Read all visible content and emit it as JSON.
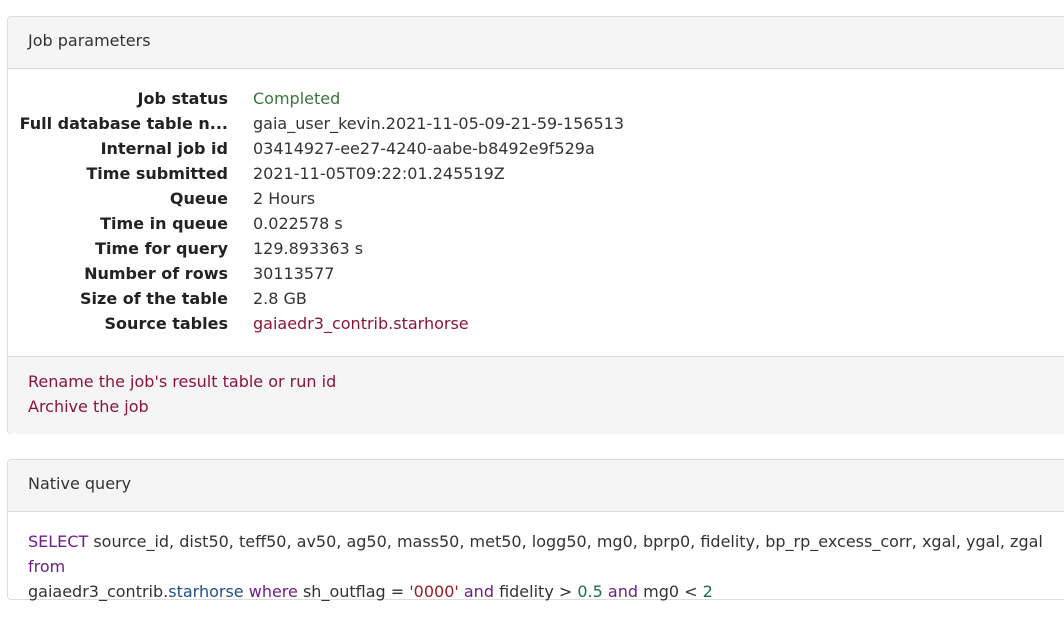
{
  "job_panel": {
    "title": "Job parameters",
    "rows": [
      {
        "label": "Job status",
        "value": "Completed"
      },
      {
        "label": "Full database table n...",
        "value": "gaia_user_kevin.2021-11-05-09-21-59-156513"
      },
      {
        "label": "Internal job id",
        "value": "03414927-ee27-4240-aabe-b8492e9f529a"
      },
      {
        "label": "Time submitted",
        "value": "2021-11-05T09:22:01.245519Z"
      },
      {
        "label": "Queue",
        "value": "2 Hours"
      },
      {
        "label": "Time in queue",
        "value": "0.022578 s"
      },
      {
        "label": "Time for query",
        "value": "129.893363 s"
      },
      {
        "label": "Number of rows",
        "value": "30113577"
      },
      {
        "label": "Size of the table",
        "value": "2.8 GB"
      },
      {
        "label": "Source tables",
        "value": "gaiaedr3_contrib.starhorse"
      }
    ],
    "actions": {
      "rename": "Rename the job's result table or run id",
      "archive": "Archive the job"
    }
  },
  "query_panel": {
    "title": "Native query",
    "tokens": {
      "t0": "SELECT",
      "t1": " source_id, dist50, teff50, av50, ag50, mass50, met50, logg50, mg0, bprp0, fidelity, bp_rp_excess_corr, xgal, ygal, zgal ",
      "t2": "from",
      "t3": "gaiaedr3_contrib.",
      "t4": "starhorse",
      "t5": " ",
      "t6": "where",
      "t7": " sh_outflag = ",
      "t8": "'0000'",
      "t9": " ",
      "t10": "and",
      "t11": " fidelity > ",
      "t12": "0.5",
      "t13": " ",
      "t14": "and",
      "t15": " mg0 < ",
      "t16": "2"
    }
  },
  "colors": {
    "status_completed": "#3c763d",
    "link": "#8b1538",
    "sql_keyword": "#6f1d8a",
    "sql_identifier": "#1f4e8c",
    "sql_string": "#9b1c1c",
    "sql_number": "#1c6b56"
  }
}
